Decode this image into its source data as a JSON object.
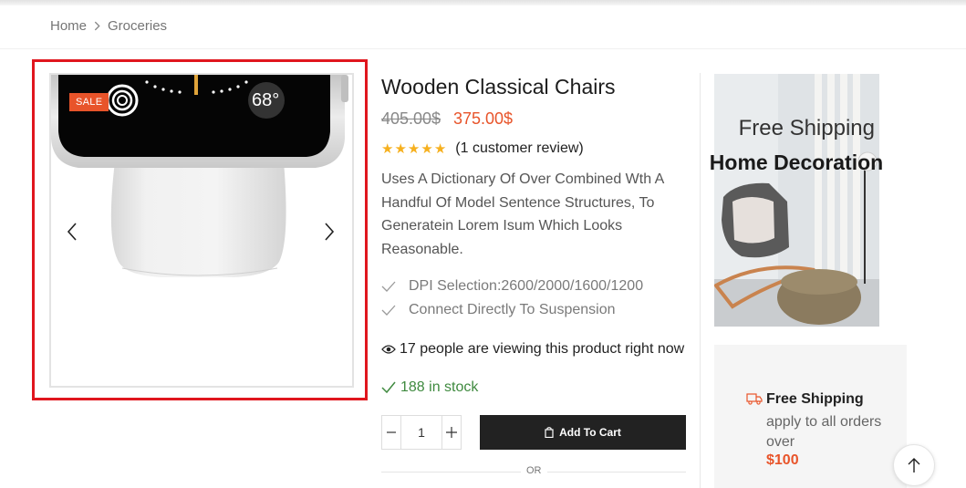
{
  "breadcrumb": {
    "home": "Home",
    "current": "Groceries"
  },
  "gallery": {
    "sale_badge": "SALE",
    "watch_temperature": "68°"
  },
  "product": {
    "title": "Wooden Classical Chairs",
    "price_old": "405.00$",
    "price_new": "375.00$",
    "rating_stars": 5,
    "review_text": "(1 customer review)",
    "description": "Uses A Dictionary Of Over Combined Wth A Handful Of Model Sentence Structures, To Generatein Lorem Isum Which Looks Reasonable.",
    "features": [
      "DPI Selection:2600/2000/1600/1200",
      "Connect Directly To Suspension"
    ],
    "viewers_text": "17 people are viewing this product right now",
    "stock_text": "188 in stock",
    "quantity": "1",
    "add_to_cart": "Add To Cart",
    "or_text": "OR"
  },
  "banner": {
    "subtitle": "Free Shipping",
    "title": "Home Decoration"
  },
  "shipping": {
    "title": "Free Shipping",
    "text": "apply to all orders over",
    "amount": "$100"
  },
  "colors": {
    "accent": "#e8542a",
    "highlight_border": "#e0161e",
    "star": "#f6b01e",
    "stock_green": "#3f8a3f",
    "button_dark": "#222222"
  },
  "icons": {
    "breadcrumb_separator": "chevron-right-icon",
    "prev": "chevron-left-icon",
    "next": "chevron-right-icon",
    "feature_check": "check-icon",
    "viewers": "eye-icon",
    "stock": "check-icon",
    "cart": "shopping-bag-icon",
    "shipping": "truck-icon",
    "scroll_top": "arrow-up-icon"
  }
}
